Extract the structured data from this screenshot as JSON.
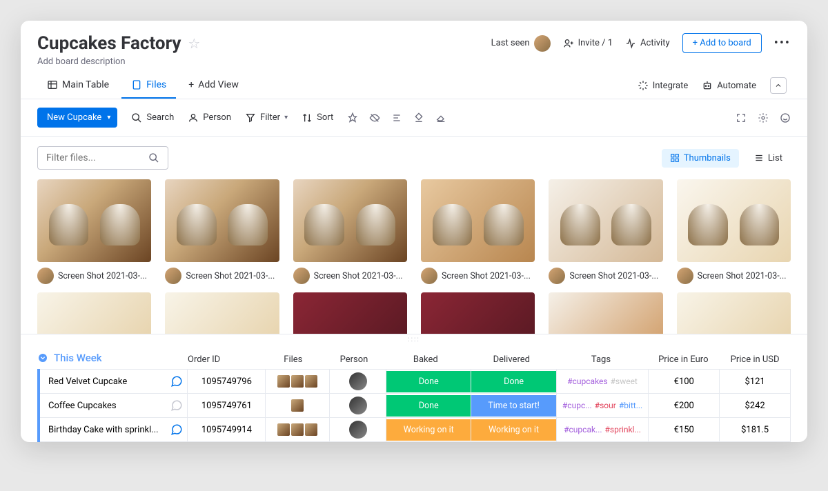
{
  "header": {
    "title": "Cupcakes Factory",
    "description": "Add board description",
    "last_seen": "Last seen",
    "invite": "Invite / 1",
    "activity": "Activity",
    "add_to_board": "Add to board"
  },
  "tabs": {
    "main_table": "Main Table",
    "files": "Files",
    "add_view": "Add View",
    "integrate": "Integrate",
    "automate": "Automate"
  },
  "toolbar": {
    "new_btn": "New Cupcake",
    "search": "Search",
    "person": "Person",
    "filter": "Filter",
    "sort": "Sort"
  },
  "file_controls": {
    "filter_placeholder": "Filter files...",
    "thumbnails": "Thumbnails",
    "list": "List"
  },
  "gallery": {
    "items": [
      {
        "name": "Screen Shot 2021-03-..."
      },
      {
        "name": "Screen Shot 2021-03-..."
      },
      {
        "name": "Screen Shot 2021-03-..."
      },
      {
        "name": "Screen Shot 2021-03-..."
      },
      {
        "name": "Screen Shot 2021-03-..."
      },
      {
        "name": "Screen Shot 2021-03-..."
      }
    ]
  },
  "group": {
    "name": "This Week",
    "columns": {
      "order_id": "Order ID",
      "files": "Files",
      "person": "Person",
      "baked": "Baked",
      "delivered": "Delivered",
      "tags": "Tags",
      "price_eur": "Price in Euro",
      "price_usd": "Price in USD"
    },
    "rows": [
      {
        "name": "Red Velvet Cupcake",
        "order_id": "1095749796",
        "baked": "Done",
        "delivered": "Done",
        "tags": [
          {
            "text": "#cupcakes",
            "cls": "tag-purple"
          },
          {
            "text": "#sweet",
            "cls": "tag-grey"
          }
        ],
        "eur": "€100",
        "usd": "$121"
      },
      {
        "name": "Coffee Cupcakes",
        "order_id": "1095749761",
        "baked": "Done",
        "delivered": "Time to start!",
        "tags": [
          {
            "text": "#cupc...",
            "cls": "tag-purple"
          },
          {
            "text": "#sour",
            "cls": "tag-red"
          },
          {
            "text": "#bitt...",
            "cls": "tag-blue"
          }
        ],
        "eur": "€200",
        "usd": "$242"
      },
      {
        "name": "Birthday Cake with sprinkl...",
        "order_id": "1095749914",
        "baked": "Working on it",
        "delivered": "Working on it",
        "tags": [
          {
            "text": "#cupcak...",
            "cls": "tag-purple"
          },
          {
            "text": "#sprinkl...",
            "cls": "tag-red"
          }
        ],
        "eur": "€150",
        "usd": "$181.5"
      }
    ]
  }
}
